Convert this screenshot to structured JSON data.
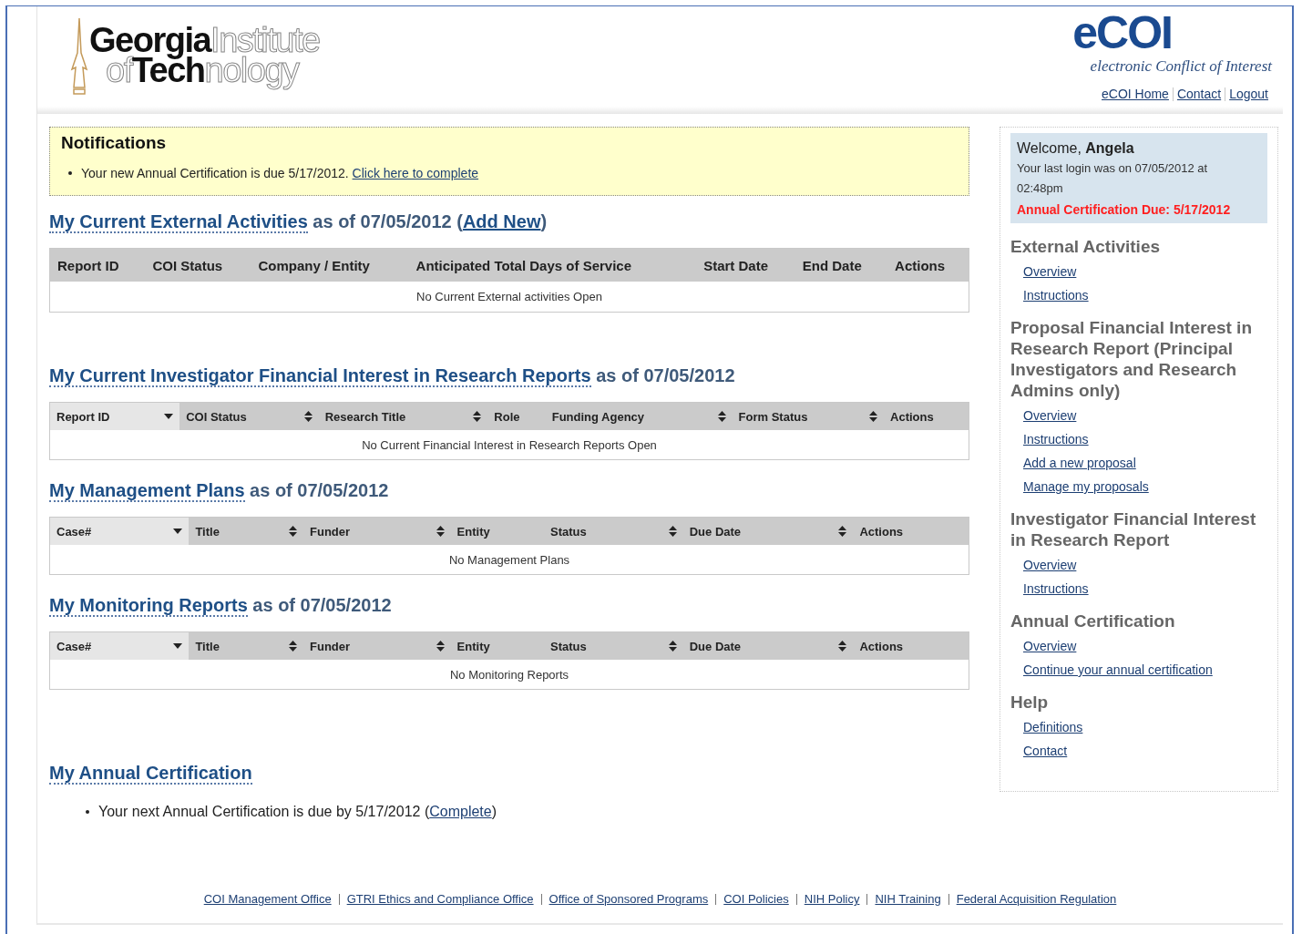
{
  "header": {
    "logo": [
      {
        "text": "Georgia",
        "kind": "solid"
      },
      {
        "text": "Institute",
        "kind": "outline"
      },
      {
        "text": "of",
        "kind": "outline"
      },
      {
        "text": "Tech",
        "kind": "solid"
      },
      {
        "text": "nology",
        "kind": "outline"
      }
    ],
    "app_name": "eCOI",
    "app_tagline": "electronic Conflict of Interest",
    "links": [
      "eCOI Home",
      "Contact",
      "Logout"
    ]
  },
  "notifications": {
    "title": "Notifications",
    "items": [
      {
        "text": "Your new Annual Certification is due 5/17/2012. ",
        "link": "Click here to complete"
      }
    ]
  },
  "sections": [
    {
      "title": "My Current External Activities",
      "suffix": "as of 07/05/2012 (",
      "link": "Add New",
      "after": ")",
      "kind": "plain",
      "columns": [
        {
          "label": "Report ID",
          "kind": "plain"
        },
        {
          "label": "COI Status",
          "kind": "plain"
        },
        {
          "label": "Company / Entity",
          "kind": "plain"
        },
        {
          "label": "Anticipated Total Days of Service",
          "kind": "plain"
        },
        {
          "label": "Start Date",
          "kind": "plain"
        },
        {
          "label": "End Date",
          "kind": "plain"
        },
        {
          "label": "Actions",
          "kind": "plain"
        }
      ],
      "empty": "No Current External activities Open"
    },
    {
      "title": "My Current Investigator Financial Interest in Research Reports",
      "suffix": "as of 07/05/2012",
      "kind": "sortable",
      "columns": [
        {
          "label": "Report ID",
          "kind": "sorted"
        },
        {
          "label": "COI Status",
          "kind": "sortable"
        },
        {
          "label": "Research Title",
          "kind": "sortable"
        },
        {
          "label": "Role",
          "kind": "plain"
        },
        {
          "label": "Funding Agency",
          "kind": "sortable"
        },
        {
          "label": "Form Status",
          "kind": "sortable"
        },
        {
          "label": "Actions",
          "kind": "plain"
        }
      ],
      "empty": "No Current Financial Interest in Research Reports Open"
    },
    {
      "title": "My Management Plans",
      "suffix": "as of 07/05/2012",
      "kind": "sortable",
      "columns": [
        {
          "label": "Case#",
          "kind": "sorted"
        },
        {
          "label": "Title",
          "kind": "sortable"
        },
        {
          "label": "Funder",
          "kind": "sortable"
        },
        {
          "label": "Entity",
          "kind": "plain"
        },
        {
          "label": "Status",
          "kind": "sortable"
        },
        {
          "label": "Due Date",
          "kind": "sortable"
        },
        {
          "label": "Actions",
          "kind": "plain"
        }
      ],
      "empty": "No Management Plans"
    },
    {
      "title": "My Monitoring Reports",
      "suffix": "as of 07/05/2012",
      "kind": "sortable",
      "columns": [
        {
          "label": "Case#",
          "kind": "sorted"
        },
        {
          "label": "Title",
          "kind": "sortable"
        },
        {
          "label": "Funder",
          "kind": "sortable"
        },
        {
          "label": "Entity",
          "kind": "plain"
        },
        {
          "label": "Status",
          "kind": "sortable"
        },
        {
          "label": "Due Date",
          "kind": "sortable"
        },
        {
          "label": "Actions",
          "kind": "plain"
        }
      ],
      "empty": "No Monitoring Reports"
    }
  ],
  "annual": {
    "title": "My Annual Certification",
    "items": [
      {
        "text": "Your next Annual Certification is due by 5/17/2012 (",
        "link": "Complete",
        "after": ")"
      }
    ]
  },
  "sidebar": {
    "welcome": {
      "greeting": "Welcome, ",
      "name": "Angela",
      "last_login": "Your last login was on 07/05/2012 at 02:48pm",
      "alert": "Annual Certification Due: 5/17/2012"
    },
    "groups": [
      {
        "title": "External Activities",
        "links": [
          "Overview",
          "Instructions"
        ]
      },
      {
        "title": "Proposal Financial Interest in Research Report (Principal Investigators and Research Admins only)",
        "links": [
          "Overview",
          "Instructions",
          "Add a new proposal",
          "Manage my proposals"
        ]
      },
      {
        "title": "Investigator Financial Interest in Research Report",
        "links": [
          "Overview",
          "Instructions"
        ]
      },
      {
        "title": "Annual Certification",
        "links": [
          "Overview",
          "Continue your annual certification"
        ]
      },
      {
        "title": "Help",
        "links": [
          "Definitions",
          "Contact"
        ]
      }
    ]
  },
  "footer": {
    "links": [
      "COI Management Office",
      "GTRI Ethics and Compliance Office",
      "Office of Sponsored Programs",
      "COI Policies",
      "NIH Policy",
      "NIH Training",
      "Federal Acquisition Regulation"
    ]
  }
}
